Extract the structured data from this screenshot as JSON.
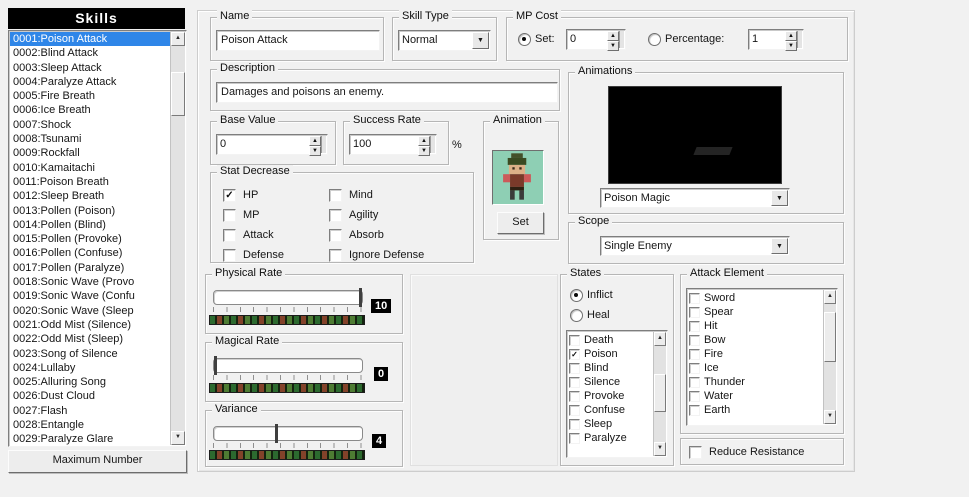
{
  "colors": {
    "selection": "#2f86e8",
    "header_bg": "#000000",
    "value_box_bg": "#000000"
  },
  "icons": {
    "dropdown_arrow": "▼",
    "spin_up": "▲",
    "spin_down": "▼",
    "scroll_up": "▲",
    "scroll_down": "▼",
    "check": "✓"
  },
  "skills_panel": {
    "title": "Skills",
    "selected_index": 0,
    "items": [
      "0001:Poison Attack",
      "0002:Blind Attack",
      "0003:Sleep Attack",
      "0004:Paralyze Attack",
      "0005:Fire Breath",
      "0006:Ice Breath",
      "0007:Shock",
      "0008:Tsunami",
      "0009:Rockfall",
      "0010:Kamaitachi",
      "0011:Poison Breath",
      "0012:Sleep Breath",
      "0013:Pollen (Poison)",
      "0014:Pollen (Blind)",
      "0015:Pollen (Provoke)",
      "0016:Pollen (Confuse)",
      "0017:Pollen (Paralyze)",
      "0018:Sonic Wave (Provo",
      "0019:Sonic Wave (Confu",
      "0020:Sonic Wave (Sleep",
      "0021:Odd Mist (Silence)",
      "0022:Odd Mist (Sleep)",
      "0023:Song of Silence",
      "0024:Lullaby",
      "0025:Alluring Song",
      "0026:Dust Cloud",
      "0027:Flash",
      "0028:Entangle",
      "0029:Paralyze Glare"
    ],
    "maximum_number_button": "Maximum Number"
  },
  "form": {
    "name": {
      "label": "Name",
      "value": "Poison Attack"
    },
    "skill_type": {
      "label": "Skill Type",
      "value": "Normal"
    },
    "mp_cost": {
      "label": "MP Cost",
      "set_label": "Set:",
      "set_value": "0",
      "set_selected": true,
      "percentage_label": "Percentage:",
      "percentage_value": "1",
      "percentage_selected": false
    },
    "description": {
      "label": "Description",
      "value": "Damages and poisons an enemy."
    },
    "base_value": {
      "label": "Base Value",
      "value": "0"
    },
    "success_rate": {
      "label": "Success Rate",
      "value": "100",
      "unit": "%"
    },
    "animation": {
      "label": "Animation",
      "set_button": "Set"
    },
    "stat_decrease": {
      "label": "Stat Decrease",
      "items": [
        {
          "label": "HP",
          "checked": true
        },
        {
          "label": "MP",
          "checked": false
        },
        {
          "label": "Attack",
          "checked": false
        },
        {
          "label": "Defense",
          "checked": false
        },
        {
          "label": "Mind",
          "checked": false
        },
        {
          "label": "Agility",
          "checked": false
        },
        {
          "label": "Absorb",
          "checked": false
        },
        {
          "label": "Ignore Defense",
          "checked": false
        }
      ]
    },
    "animations": {
      "label": "Animations",
      "selected": "Poison Magic"
    },
    "scope": {
      "label": "Scope",
      "selected": "Single Enemy"
    },
    "physical_rate": {
      "label": "Physical Rate",
      "value": "10",
      "position": 1
    },
    "magical_rate": {
      "label": "Magical Rate",
      "value": "0",
      "position": 0
    },
    "variance": {
      "label": "Variance",
      "value": "4",
      "position": 0.42
    },
    "states": {
      "label": "States",
      "inflict_label": "Inflict",
      "inflict_selected": true,
      "heal_label": "Heal",
      "heal_selected": false,
      "items": [
        {
          "label": "Death",
          "checked": false
        },
        {
          "label": "Poison",
          "checked": true
        },
        {
          "label": "Blind",
          "checked": false
        },
        {
          "label": "Silence",
          "checked": false
        },
        {
          "label": "Provoke",
          "checked": false
        },
        {
          "label": "Confuse",
          "checked": false
        },
        {
          "label": "Sleep",
          "checked": false
        },
        {
          "label": "Paralyze",
          "checked": false
        }
      ]
    },
    "attack_element": {
      "label": "Attack Element",
      "items": [
        {
          "label": "Sword",
          "checked": false
        },
        {
          "label": "Spear",
          "checked": false
        },
        {
          "label": "Hit",
          "checked": false
        },
        {
          "label": "Bow",
          "checked": false
        },
        {
          "label": "Fire",
          "checked": false
        },
        {
          "label": "Ice",
          "checked": false
        },
        {
          "label": "Thunder",
          "checked": false
        },
        {
          "label": "Water",
          "checked": false
        },
        {
          "label": "Earth",
          "checked": false
        }
      ]
    },
    "reduce_resistance": {
      "label": "Reduce Resistance",
      "checked": false
    }
  }
}
